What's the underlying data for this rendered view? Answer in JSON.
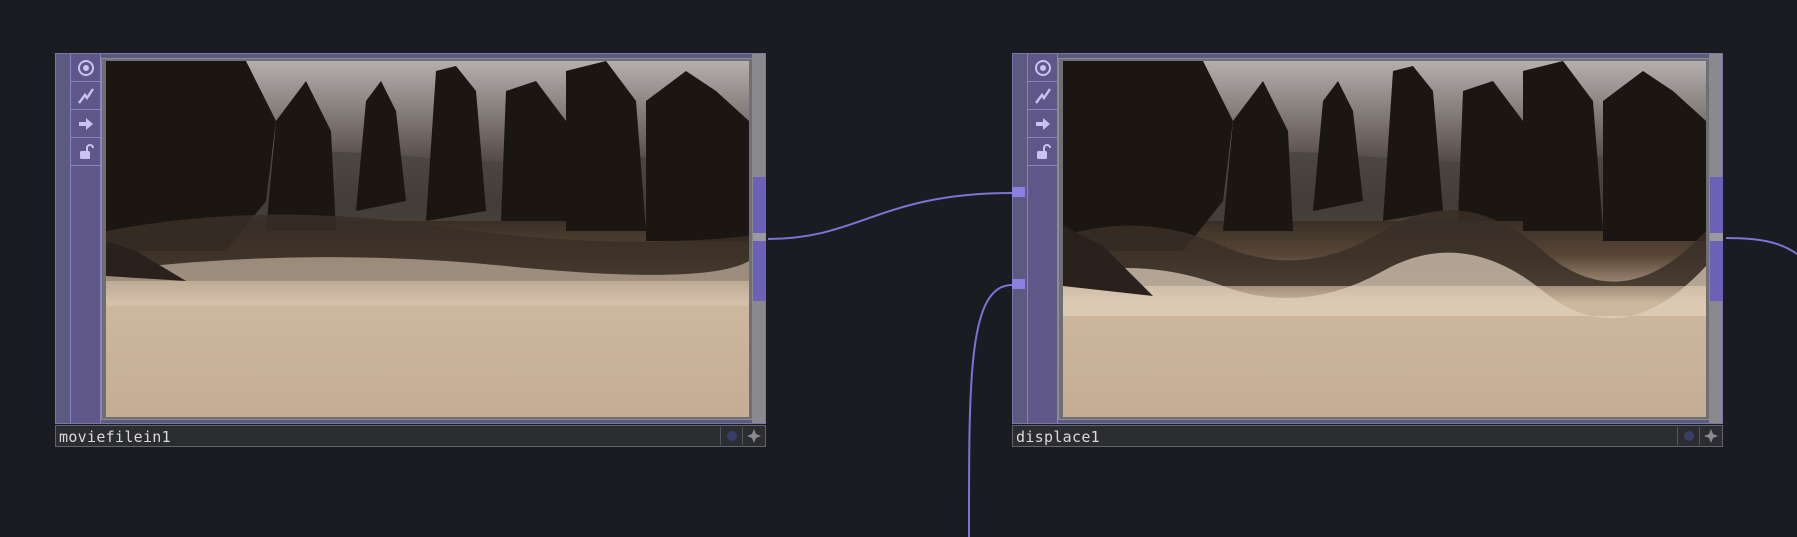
{
  "nodes": [
    {
      "name": "moviefilein1",
      "flags": [
        "viewer-active-icon",
        "cook-icon",
        "export-icon",
        "lock-icon"
      ],
      "preview": "misty lake with pine trees",
      "colors": {
        "frame": "#5d5a82",
        "flag_strip": "#5f5787",
        "connector": "#6c60b8"
      }
    },
    {
      "name": "displace1",
      "flags": [
        "viewer-active-icon",
        "cook-icon",
        "export-icon",
        "lock-icon"
      ],
      "preview": "displaced misty lake with pine trees",
      "colors": {
        "frame": "#5d5a82",
        "flag_strip": "#5f5787",
        "connector": "#6c60b8"
      }
    }
  ],
  "wires": [
    {
      "from": "moviefilein1",
      "to": "displace1",
      "input": 0
    },
    {
      "from": "offscreen-below",
      "to": "displace1",
      "input": 1
    },
    {
      "from": "displace1",
      "to": "offscreen-right",
      "input": 0
    }
  ],
  "colors": {
    "background": "#1b1c21",
    "wire": "#7b74d6"
  }
}
